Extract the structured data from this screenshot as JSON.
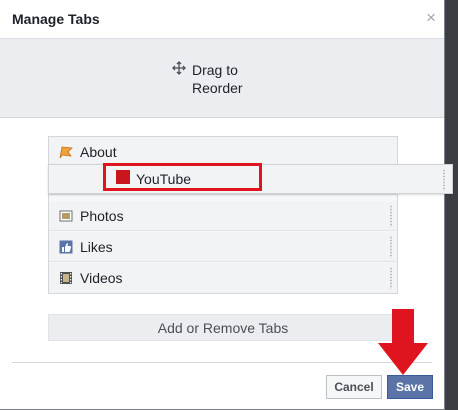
{
  "dialog": {
    "title": "Manage Tabs",
    "close_glyph": "×"
  },
  "hint": {
    "icon": "move-icon",
    "text": "Drag to Reorder"
  },
  "tabs": [
    {
      "label": "About",
      "icon": "flag-icon"
    },
    {
      "label": "YouTube",
      "icon": "youtube-swatch-icon",
      "dragging": true
    },
    {
      "label": "Photos",
      "icon": "photo-icon"
    },
    {
      "label": "Likes",
      "icon": "thumbs-up-icon"
    },
    {
      "label": "Videos",
      "icon": "film-icon"
    }
  ],
  "add_remove_label": "Add or Remove Tabs",
  "buttons": {
    "cancel": "Cancel",
    "save": "Save"
  },
  "colors": {
    "highlight_box": "#e0141e",
    "annotation_arrow": "#e0141e",
    "save_button": "#5b74a8",
    "youtube_swatch": "#c8161f"
  }
}
